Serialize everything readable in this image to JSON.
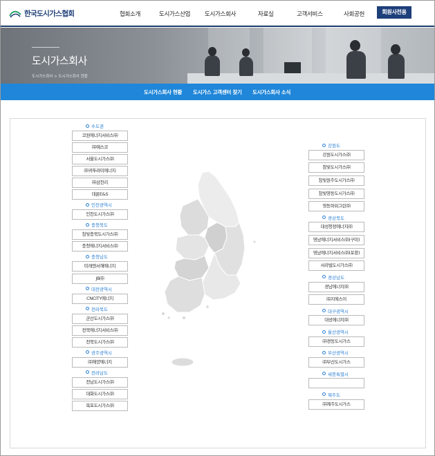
{
  "header": {
    "logo_text": "한국도시가스협회",
    "nav": [
      "협회소개",
      "도시가스산업",
      "도시가스회사",
      "자료실",
      "고객서비스",
      "사회공헌"
    ],
    "member_button": "회원사전용"
  },
  "hero": {
    "title": "도시가스회사",
    "breadcrumb": "도시가스회사 > 도시가스회사 현황"
  },
  "tabs": [
    "도시가스회사 현황",
    "도시가스 고객센터 찾기",
    "도시가스회사 소식"
  ],
  "left_regions": [
    {
      "name": "수도권",
      "companies": [
        "코원에너지서비스㈜",
        "㈜예스코",
        "서울도시가스㈜",
        "㈜귀뚜라미에너지",
        "㈜삼천리",
        "대륜E&S"
      ]
    },
    {
      "name": "인천광역시",
      "companies": [
        "인천도시가스㈜"
      ]
    },
    {
      "name": "충청북도",
      "companies": [
        "참빛충북도시가스㈜",
        "충청에너지서비스㈜"
      ]
    },
    {
      "name": "충청남도",
      "companies": [
        "미래엔서해에너지",
        "JB㈜"
      ]
    },
    {
      "name": "대전광역시",
      "companies": [
        "CNCITY에너지"
      ]
    },
    {
      "name": "전라북도",
      "companies": [
        "군산도시가스㈜",
        "전북에너지서비스㈜",
        "전북도시가스㈜"
      ]
    },
    {
      "name": "광주광역시",
      "companies": [
        "㈜해양에너지"
      ]
    },
    {
      "name": "전라남도",
      "companies": [
        "전남도시가스㈜",
        "대화도시가스㈜",
        "목포도시가스㈜"
      ]
    }
  ],
  "right_regions": [
    {
      "name": "강원도",
      "companies": [
        "강원도시가스㈜",
        "참빛도시가스㈜",
        "참빛원주도시가스㈜",
        "참빛영동도시가스㈜",
        "영동파워그린㈜"
      ]
    },
    {
      "name": "경상북도",
      "companies": [
        "대성청정에너지㈜",
        "영남에너지서비스㈜(구미)",
        "영남에너지서비스㈜(포항)",
        "서라벌도시가스㈜"
      ]
    },
    {
      "name": "경상남도",
      "companies": [
        "경남에너지㈜",
        "㈜지에스이"
      ]
    },
    {
      "name": "대구광역시",
      "companies": [
        "대성에너지㈜"
      ]
    },
    {
      "name": "울산광역시",
      "companies": [
        "㈜경동도시가스"
      ]
    },
    {
      "name": "부산광역시",
      "companies": [
        "㈜부산도시가스"
      ]
    },
    {
      "name": "세종특별시",
      "companies": [
        ""
      ]
    },
    {
      "name": "제주도",
      "companies": [
        "㈜제주도시가스"
      ]
    }
  ],
  "colors": {
    "header_navy": "#1d3f7a",
    "tab_blue": "#1f86d9",
    "region_blue": "#2a7fd4"
  },
  "icons": {
    "logo": "kcga-logo-icon",
    "region_marker": "circle-marker-icon"
  }
}
